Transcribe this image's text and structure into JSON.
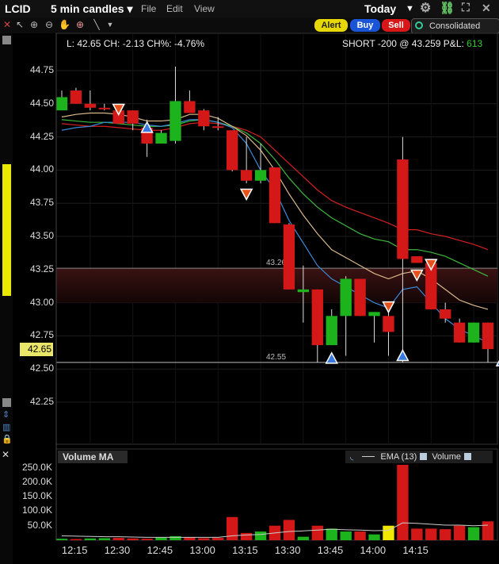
{
  "header": {
    "symbol": "LCID",
    "interval": "5 min candles ▾",
    "menu": [
      "File",
      "Edit",
      "View"
    ],
    "period": "Today",
    "buttons": {
      "alert": "Alert",
      "buy": "Buy",
      "sell": "Sell",
      "consolidated": "Consolidated"
    }
  },
  "info": {
    "quote": "L: 42.65 CH: -2.13 CH%: -4.76%",
    "position": "SHORT -200 @ 43.259 P&L: ",
    "pnl": "613"
  },
  "price_axis": {
    "labels": [
      "44.75",
      "44.50",
      "44.25",
      "44.00",
      "43.75",
      "43.50",
      "43.25",
      "43.00",
      "42.75",
      "42.50",
      "42.25"
    ],
    "last_price": "42.65"
  },
  "levels": {
    "upper": "43.26",
    "lower": "42.55"
  },
  "volume_pane": {
    "title": "Volume MA",
    "legend": {
      "ema": "EMA (13)",
      "volume": "Volume"
    },
    "axis_labels": [
      "250.0K",
      "200.0K",
      "150.0K",
      "100.0K",
      "50.0K"
    ]
  },
  "time_axis": [
    "12:15",
    "12:30",
    "12:45",
    "13:00",
    "13:15",
    "13:30",
    "13:45",
    "14:00",
    "14:15"
  ],
  "colors": {
    "up": "#1db31d",
    "down": "#d41818",
    "band": "#4a1414",
    "accent": "#e9e66a"
  },
  "chart_data": {
    "type": "candlestick",
    "ylim": [
      42.0,
      44.9
    ],
    "candles": [
      {
        "o": 44.45,
        "h": 44.6,
        "l": 44.45,
        "c": 44.55
      },
      {
        "o": 44.6,
        "h": 44.62,
        "l": 44.5,
        "c": 44.5
      },
      {
        "o": 44.5,
        "h": 44.6,
        "l": 44.45,
        "c": 44.47
      },
      {
        "o": 44.47,
        "h": 44.5,
        "l": 44.45,
        "c": 44.46
      },
      {
        "o": 44.45,
        "h": 44.5,
        "l": 44.35,
        "c": 44.35
      },
      {
        "o": 44.45,
        "h": 44.45,
        "l": 44.3,
        "c": 44.35
      },
      {
        "o": 44.32,
        "h": 44.38,
        "l": 44.1,
        "c": 44.2
      },
      {
        "o": 44.2,
        "h": 44.3,
        "l": 44.2,
        "c": 44.28
      },
      {
        "o": 44.22,
        "h": 44.78,
        "l": 44.2,
        "c": 44.52
      },
      {
        "o": 44.52,
        "h": 44.6,
        "l": 44.43,
        "c": 44.43
      },
      {
        "o": 44.45,
        "h": 44.46,
        "l": 44.3,
        "c": 44.33
      },
      {
        "o": 44.33,
        "h": 44.4,
        "l": 44.3,
        "c": 44.32
      },
      {
        "o": 44.3,
        "h": 44.3,
        "l": 43.99,
        "c": 44.0
      },
      {
        "o": 44.0,
        "h": 44.25,
        "l": 43.9,
        "c": 43.92
      },
      {
        "o": 43.92,
        "h": 44.2,
        "l": 43.9,
        "c": 44.0
      },
      {
        "o": 44.02,
        "h": 44.02,
        "l": 43.6,
        "c": 43.6
      },
      {
        "o": 43.59,
        "h": 43.6,
        "l": 43.1,
        "c": 43.1
      },
      {
        "o": 43.08,
        "h": 43.28,
        "l": 42.85,
        "c": 43.1
      },
      {
        "o": 43.1,
        "h": 43.1,
        "l": 42.55,
        "c": 42.68
      },
      {
        "o": 42.68,
        "h": 42.95,
        "l": 42.68,
        "c": 42.9
      },
      {
        "o": 42.9,
        "h": 43.2,
        "l": 42.6,
        "c": 43.18
      },
      {
        "o": 43.18,
        "h": 43.18,
        "l": 42.9,
        "c": 42.9
      },
      {
        "o": 42.9,
        "h": 42.92,
        "l": 42.7,
        "c": 42.93
      },
      {
        "o": 42.9,
        "h": 42.95,
        "l": 42.6,
        "c": 42.78
      },
      {
        "o": 44.08,
        "h": 44.25,
        "l": 42.55,
        "c": 43.33
      },
      {
        "o": 43.35,
        "h": 43.35,
        "l": 43.3,
        "c": 43.3
      },
      {
        "o": 43.3,
        "h": 43.32,
        "l": 42.95,
        "c": 42.95
      },
      {
        "o": 42.95,
        "h": 43.0,
        "l": 42.85,
        "c": 42.88
      },
      {
        "o": 42.85,
        "h": 42.88,
        "l": 42.7,
        "c": 42.7
      },
      {
        "o": 42.7,
        "h": 42.85,
        "l": 42.7,
        "c": 42.85
      },
      {
        "o": 42.85,
        "h": 42.85,
        "l": 42.55,
        "c": 42.65
      }
    ],
    "ma_series": [
      {
        "color": "#d42020",
        "values": [
          44.35,
          44.34,
          44.33,
          44.33,
          44.32,
          44.31,
          44.3,
          44.3,
          44.32,
          44.35,
          44.36,
          44.35,
          44.33,
          44.3,
          44.25,
          44.15,
          44.05,
          43.95,
          43.85,
          43.77,
          43.72,
          43.68,
          43.64,
          43.6,
          43.55,
          43.55,
          43.52,
          43.5,
          43.47,
          43.44,
          43.4
        ]
      },
      {
        "color": "#3cb83c",
        "values": [
          44.38,
          44.37,
          44.36,
          44.36,
          44.35,
          44.34,
          44.33,
          44.33,
          44.34,
          44.37,
          44.38,
          44.36,
          44.33,
          44.28,
          44.2,
          44.08,
          43.94,
          43.82,
          43.72,
          43.64,
          43.58,
          43.52,
          43.48,
          43.46,
          43.4,
          43.4,
          43.38,
          43.35,
          43.3,
          43.25,
          43.2
        ]
      },
      {
        "color": "#d9b98a",
        "values": [
          44.4,
          44.42,
          44.43,
          44.43,
          44.42,
          44.4,
          44.37,
          44.37,
          44.38,
          44.42,
          44.42,
          44.39,
          44.33,
          44.26,
          44.15,
          44.0,
          43.82,
          43.66,
          43.52,
          43.4,
          43.34,
          43.28,
          43.22,
          43.18,
          43.22,
          43.24,
          43.18,
          43.1,
          43.02,
          42.98,
          42.95
        ]
      },
      {
        "color": "#3c8ad8",
        "values": [
          44.3,
          44.32,
          44.33,
          44.36,
          44.36,
          44.36,
          44.34,
          44.33,
          44.35,
          44.38,
          44.38,
          44.36,
          44.32,
          44.2,
          44.0,
          43.85,
          43.62,
          43.45,
          43.28,
          43.18,
          43.12,
          43.06,
          43.0,
          42.96,
          43.1,
          43.12,
          43.0,
          42.88,
          42.8,
          42.75,
          42.7
        ]
      }
    ],
    "markers": [
      {
        "i": 4,
        "price": 44.46,
        "dir": "down"
      },
      {
        "i": 6,
        "price": 44.32,
        "dir": "up"
      },
      {
        "i": 13,
        "price": 43.82,
        "dir": "down"
      },
      {
        "i": 19,
        "price": 42.58,
        "dir": "up"
      },
      {
        "i": 23,
        "price": 42.97,
        "dir": "down"
      },
      {
        "i": 24,
        "price": 42.6,
        "dir": "up"
      },
      {
        "i": 25,
        "price": 43.21,
        "dir": "down"
      },
      {
        "i": 26,
        "price": 43.29,
        "dir": "down"
      },
      {
        "i": 31,
        "price": 42.56,
        "dir": "up"
      }
    ],
    "volume": {
      "ylim": [
        0,
        260000
      ],
      "values": [
        5000,
        4000,
        6000,
        7000,
        8000,
        6000,
        5000,
        9000,
        14000,
        10000,
        7000,
        8000,
        80000,
        25000,
        30000,
        50000,
        70000,
        12000,
        50000,
        40000,
        30000,
        30000,
        20000,
        50000,
        260000,
        40000,
        40000,
        38000,
        50000,
        45000,
        65000
      ],
      "up": [
        true,
        false,
        true,
        true,
        false,
        false,
        false,
        true,
        true,
        false,
        false,
        false,
        false,
        false,
        true,
        false,
        false,
        true,
        false,
        true,
        true,
        false,
        true,
        false,
        false,
        false,
        false,
        false,
        false,
        true,
        false
      ],
      "highlight": 23,
      "ema": [
        15000,
        14000,
        13000,
        12000,
        12000,
        11000,
        10000,
        10000,
        10000,
        10000,
        10000,
        10000,
        15000,
        18000,
        20000,
        25000,
        30000,
        32000,
        35000,
        38000,
        36000,
        35000,
        33000,
        34000,
        60000,
        58000,
        55000,
        52000,
        52000,
        50000,
        52000
      ]
    }
  }
}
